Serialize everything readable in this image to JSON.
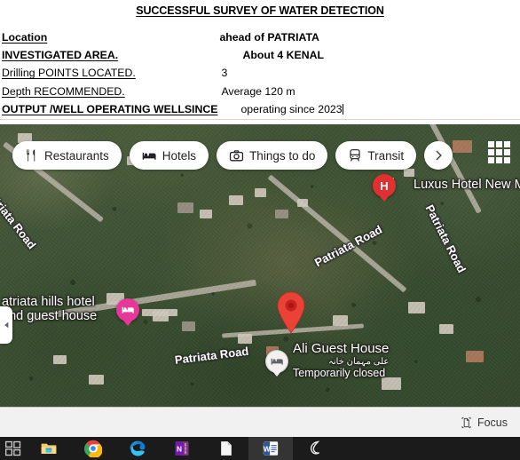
{
  "document": {
    "title": "SUCCESSFUL SURVEY OF WATER DETECTION",
    "rows": [
      {
        "label": "Location",
        "value": "ahead of PATRIATA"
      },
      {
        "label": "INVESTIGATED AREA.",
        "value": "About 4 KENAL"
      },
      {
        "label": "Drilling POINTS LOCATED.",
        "value": "3"
      },
      {
        "label": "Depth RECOMMENDED.",
        "value": "Average 120 m"
      },
      {
        "label": "OUTPUT /WELL OPERATING WELLSINCE",
        "value": "operating since 2023"
      }
    ]
  },
  "map": {
    "chips": [
      {
        "label": "Restaurants",
        "icon": "restaurant-icon"
      },
      {
        "label": "Hotels",
        "icon": "hotel-bed-icon"
      },
      {
        "label": "Things to do",
        "icon": "camera-icon"
      },
      {
        "label": "Transit",
        "icon": "train-icon"
      }
    ],
    "next_chip_icon": "chevron-right-icon",
    "grid_icon": "grid-3x3-icon",
    "collapse_icon": "chevron-left-icon",
    "road_labels": [
      {
        "text": "Patriata Road"
      },
      {
        "text": "Patriata Road"
      },
      {
        "text": "Patriata Road"
      },
      {
        "text": "Patriata Road"
      }
    ],
    "pois": [
      {
        "name": "Luxus Hotel New M",
        "pin": "hotel-h-pin",
        "pin_glyph": "H",
        "sub": "",
        "status": ""
      },
      {
        "name_line1": "atriata hills hotel",
        "name_line2": "and guest house",
        "pin": "hotel-bed-pin",
        "sub": "",
        "status": ""
      },
      {
        "name": "Ali Guest House",
        "sub": "علی مہمان خانہ",
        "status": "Temporarily closed",
        "pin": "lodging-bed-pin"
      }
    ],
    "selected_place_pin": "red-map-pin",
    "colors": {
      "hotel_pin": "#e8379a",
      "hotel_h_pin": "#e03030",
      "selected_pin": "#ea4335"
    }
  },
  "statusbar": {
    "focus_label": "Focus",
    "focus_icon": "focus-mode-icon"
  },
  "taskbar": {
    "items": [
      {
        "name": "widgets",
        "icon": "widgets-icon",
        "active": false
      },
      {
        "name": "file-explorer",
        "icon": "folder-icon",
        "active": false
      },
      {
        "name": "google-chrome",
        "icon": "chrome-icon",
        "active": false
      },
      {
        "name": "microsoft-edge",
        "icon": "edge-icon",
        "active": false
      },
      {
        "name": "onenote",
        "icon": "onenote-icon",
        "active": false
      },
      {
        "name": "document",
        "icon": "document-icon",
        "active": false
      },
      {
        "name": "microsoft-word",
        "icon": "word-icon",
        "active": true
      },
      {
        "name": "app",
        "icon": "swirl-icon",
        "active": false
      }
    ]
  }
}
